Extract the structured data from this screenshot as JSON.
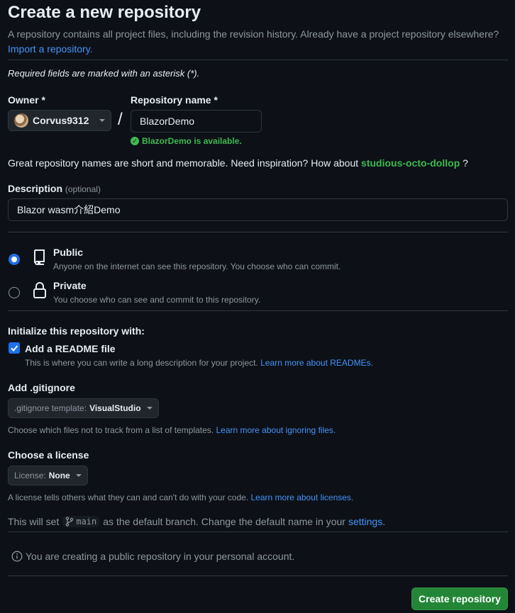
{
  "header": {
    "title": "Create a new repository",
    "subtitle": "A repository contains all project files, including the revision history. Already have a project repository elsewhere?",
    "import_link": "Import a repository."
  },
  "required_note": "Required fields are marked with an asterisk (*).",
  "owner": {
    "label": "Owner *",
    "value": "Corvus9312"
  },
  "repo_name": {
    "label": "Repository name *",
    "value": "BlazorDemo",
    "availability": "BlazorDemo is available."
  },
  "inspiration": {
    "text": "Great repository names are short and memorable. Need inspiration? How about",
    "suggestion": "studious-octo-dollop",
    "suffix": "?"
  },
  "description": {
    "label": "Description",
    "optional": "(optional)",
    "value": "Blazor wasm介紹Demo"
  },
  "visibility": {
    "public": {
      "title": "Public",
      "desc": "Anyone on the internet can see this repository. You choose who can commit.",
      "selected": true
    },
    "private": {
      "title": "Private",
      "desc": "You choose who can see and commit to this repository.",
      "selected": false
    }
  },
  "initialize": {
    "label": "Initialize this repository with:",
    "readme": {
      "title": "Add a README file",
      "desc": "This is where you can write a long description for your project.",
      "link": "Learn more about READMEs.",
      "checked": true
    }
  },
  "gitignore": {
    "label": "Add .gitignore",
    "prefix": ".gitignore template:",
    "value": "VisualStudio",
    "desc": "Choose which files not to track from a list of templates.",
    "link": "Learn more about ignoring files."
  },
  "license": {
    "label": "Choose a license",
    "prefix": "License:",
    "value": "None",
    "desc": "A license tells others what they can and can't do with your code.",
    "link": "Learn more about licenses."
  },
  "branch": {
    "pre": "This will set",
    "name": "main",
    "post": "as the default branch. Change the default name in your",
    "link": "settings",
    "end": "."
  },
  "notice": "You are creating a public repository in your personal account.",
  "submit_label": "Create repository",
  "colors": {
    "accent": "#1f6feb",
    "success": "#238636",
    "link": "#4493f8",
    "bg": "#0d1117"
  }
}
